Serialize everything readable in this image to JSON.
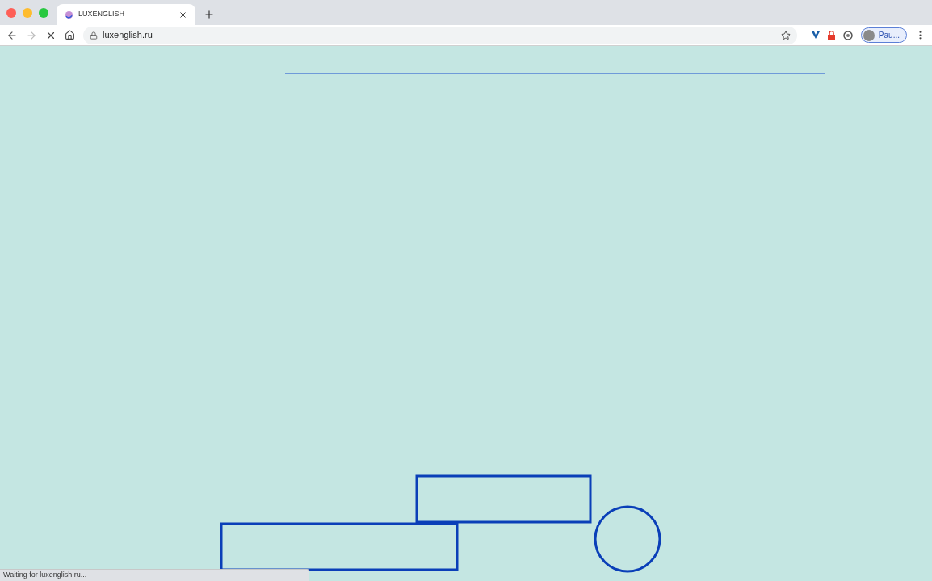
{
  "tabs": [
    {
      "title": "LUXENGLISH",
      "selected": true
    }
  ],
  "toolbar": {
    "loading": true,
    "url": "luxenglish.ru",
    "profile": "Pau..."
  },
  "status_bar": {
    "text": "Waiting for luxenglish.ru..."
  }
}
